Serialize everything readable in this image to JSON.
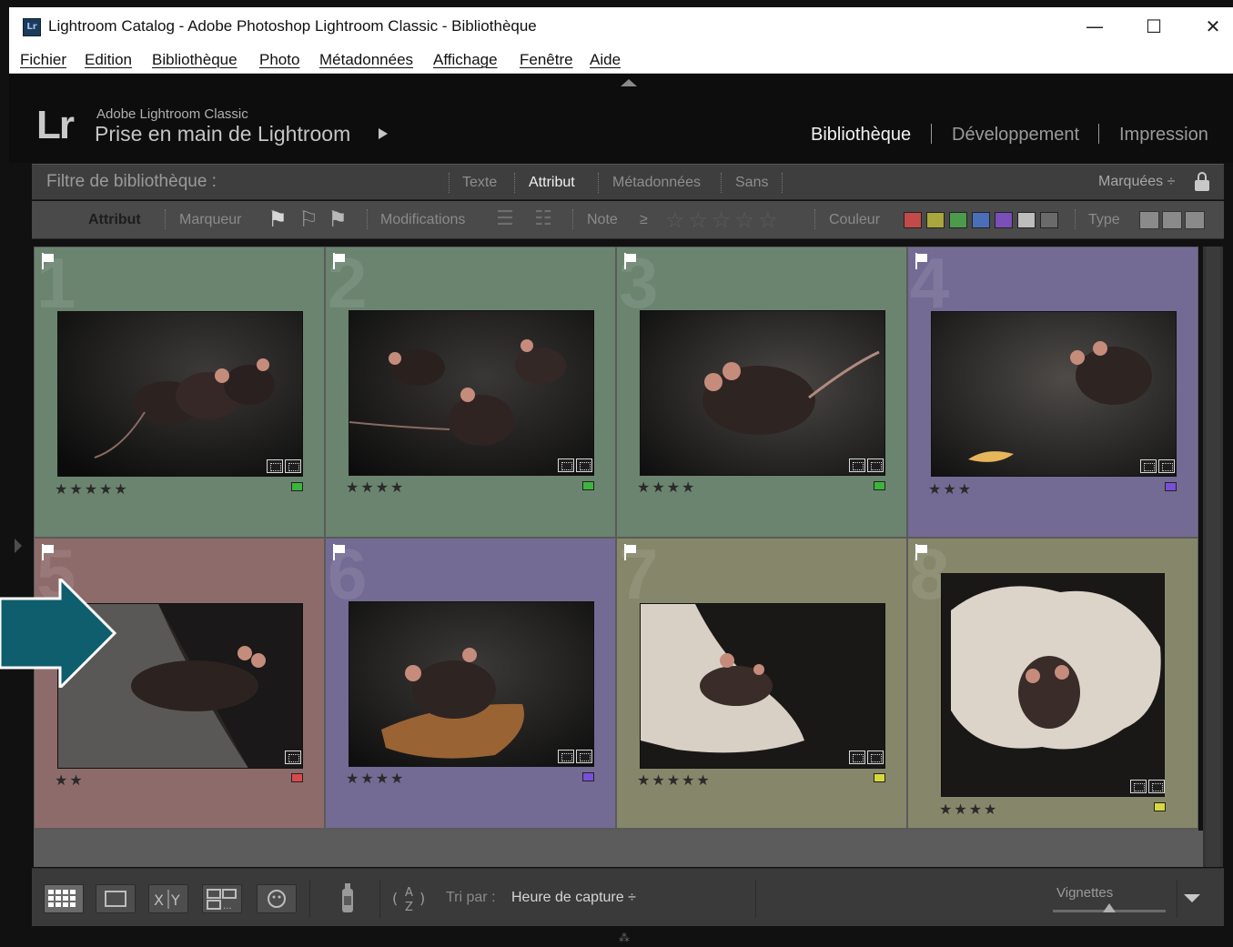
{
  "window": {
    "title": "Lightroom Catalog - Adobe Photoshop Lightroom Classic - Bibliothèque",
    "app_icon_text": "Lr",
    "controls": {
      "minimize": "—",
      "maximize": "☐",
      "close": "✕"
    }
  },
  "menu": [
    "Fichier",
    "Edition",
    "Bibliothèque",
    "Photo",
    "Métadonnées",
    "Affichage",
    "Fenêtre",
    "Aide"
  ],
  "identity": {
    "logo": "Lr",
    "product": "Adobe Lightroom Classic",
    "catalog": "Prise en main de Lightroom"
  },
  "modules": [
    {
      "label": "Bibliothèque",
      "active": true
    },
    {
      "label": "Développement",
      "active": false
    },
    {
      "label": "Impression",
      "active": false
    }
  ],
  "filter_bar": {
    "title": "Filtre de bibliothèque :",
    "tabs": [
      {
        "label": "Texte",
        "active": false
      },
      {
        "label": "Attribut",
        "active": true
      },
      {
        "label": "Métadonnées",
        "active": false
      },
      {
        "label": "Sans",
        "active": false
      }
    ],
    "preset": "Marquées ÷"
  },
  "attribute_bar": {
    "title": "Attribut",
    "flag_label": "Marqueur",
    "edit_label": "Modifications",
    "rating_label": "Note",
    "rating_op": "≥",
    "rating_stars": "☆☆☆☆☆",
    "color_label": "Couleur",
    "type_label": "Type",
    "colors": [
      "#c24a4a",
      "#a9a63c",
      "#4c9a4c",
      "#4a6fb8",
      "#7a4fb8",
      "#bdbdbd",
      "#6a6a6a"
    ]
  },
  "grid": {
    "cells": [
      {
        "index": "1",
        "rating": "★★★★★",
        "stars": 5,
        "label_color": "#3cb43c",
        "bg": "#6a8470"
      },
      {
        "index": "2",
        "rating": "★★★★",
        "stars": 4,
        "label_color": "#3cb43c",
        "bg": "#6a8470"
      },
      {
        "index": "3",
        "rating": "★★★★",
        "stars": 4,
        "label_color": "#3cb43c",
        "bg": "#6a8470"
      },
      {
        "index": "4",
        "rating": "★★★",
        "stars": 3,
        "label_color": "#7a4fd8",
        "bg": "#746b94"
      },
      {
        "index": "5",
        "rating": "★★",
        "stars": 2,
        "label_color": "#d84a4a",
        "bg": "#8e6b6b"
      },
      {
        "index": "6",
        "rating": "★★★★",
        "stars": 4,
        "label_color": "#7a4fd8",
        "bg": "#746b94"
      },
      {
        "index": "7",
        "rating": "★★★★★",
        "stars": 5,
        "label_color": "#d8d83c",
        "bg": "#86876a"
      },
      {
        "index": "8",
        "rating": "★★★★",
        "stars": 4,
        "label_color": "#d8d83c",
        "bg": "#86876a"
      }
    ]
  },
  "toolbar": {
    "sort_label": "Tri par :",
    "sort_value": "Heure de capture ÷",
    "thumbnails_label": "Vignettes",
    "thumbnail_size": 0.5
  }
}
